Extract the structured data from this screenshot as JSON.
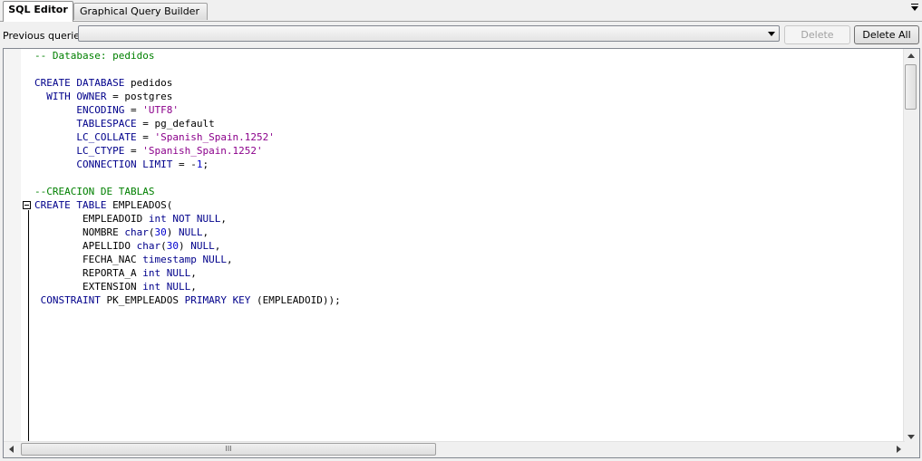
{
  "tabs": [
    {
      "label": "SQL Editor",
      "active": true
    },
    {
      "label": "Graphical Query Builder",
      "active": false
    }
  ],
  "previous_queries": {
    "label": "Previous queries",
    "selected": "",
    "delete_label": "Delete",
    "delete_all_label": "Delete All"
  },
  "scrollbar": {
    "h_thumb_grip": "III"
  },
  "editor": {
    "lines": [
      [
        {
          "t": "-- Database: pedidos",
          "c": "com"
        }
      ],
      [],
      [
        {
          "t": "CREATE",
          "c": "kw"
        },
        {
          "t": " "
        },
        {
          "t": "DATABASE",
          "c": "kw"
        },
        {
          "t": " pedidos"
        }
      ],
      [
        {
          "t": "  "
        },
        {
          "t": "WITH",
          "c": "kw"
        },
        {
          "t": " "
        },
        {
          "t": "OWNER",
          "c": "kw"
        },
        {
          "t": " = postgres"
        }
      ],
      [
        {
          "t": "       "
        },
        {
          "t": "ENCODING",
          "c": "kw"
        },
        {
          "t": " = "
        },
        {
          "t": "'UTF8'",
          "c": "str"
        }
      ],
      [
        {
          "t": "       "
        },
        {
          "t": "TABLESPACE",
          "c": "kw"
        },
        {
          "t": " = pg_default"
        }
      ],
      [
        {
          "t": "       "
        },
        {
          "t": "LC_COLLATE",
          "c": "kw"
        },
        {
          "t": " = "
        },
        {
          "t": "'Spanish_Spain.1252'",
          "c": "str"
        }
      ],
      [
        {
          "t": "       "
        },
        {
          "t": "LC_CTYPE",
          "c": "kw"
        },
        {
          "t": " = "
        },
        {
          "t": "'Spanish_Spain.1252'",
          "c": "str"
        }
      ],
      [
        {
          "t": "       "
        },
        {
          "t": "CONNECTION",
          "c": "kw"
        },
        {
          "t": " "
        },
        {
          "t": "LIMIT",
          "c": "kw"
        },
        {
          "t": " = -"
        },
        {
          "t": "1",
          "c": "num"
        },
        {
          "t": ";"
        }
      ],
      [],
      [
        {
          "t": "--CREACION DE TABLAS",
          "c": "com"
        }
      ],
      [
        {
          "t": "CREATE",
          "c": "kw"
        },
        {
          "t": " "
        },
        {
          "t": "TABLE",
          "c": "kw"
        },
        {
          "t": " EMPLEADOS("
        }
      ],
      [
        {
          "t": "        EMPLEADOID "
        },
        {
          "t": "int",
          "c": "kw"
        },
        {
          "t": " "
        },
        {
          "t": "NOT",
          "c": "kw"
        },
        {
          "t": " "
        },
        {
          "t": "NULL",
          "c": "kw"
        },
        {
          "t": ","
        }
      ],
      [
        {
          "t": "        NOMBRE "
        },
        {
          "t": "char",
          "c": "kw"
        },
        {
          "t": "("
        },
        {
          "t": "30",
          "c": "num"
        },
        {
          "t": ") "
        },
        {
          "t": "NULL",
          "c": "kw"
        },
        {
          "t": ","
        }
      ],
      [
        {
          "t": "        APELLIDO "
        },
        {
          "t": "char",
          "c": "kw"
        },
        {
          "t": "("
        },
        {
          "t": "30",
          "c": "num"
        },
        {
          "t": ") "
        },
        {
          "t": "NULL",
          "c": "kw"
        },
        {
          "t": ","
        }
      ],
      [
        {
          "t": "        FECHA_NAC "
        },
        {
          "t": "timestamp",
          "c": "kw"
        },
        {
          "t": " "
        },
        {
          "t": "NULL",
          "c": "kw"
        },
        {
          "t": ","
        }
      ],
      [
        {
          "t": "        REPORTA_A "
        },
        {
          "t": "int",
          "c": "kw"
        },
        {
          "t": " "
        },
        {
          "t": "NULL",
          "c": "kw"
        },
        {
          "t": ","
        }
      ],
      [
        {
          "t": "        EXTENSION "
        },
        {
          "t": "int",
          "c": "kw"
        },
        {
          "t": " "
        },
        {
          "t": "NULL",
          "c": "kw"
        },
        {
          "t": ","
        }
      ],
      [
        {
          "t": " "
        },
        {
          "t": "CONSTRAINT",
          "c": "kw"
        },
        {
          "t": " PK_EMPLEADOS "
        },
        {
          "t": "PRIMARY",
          "c": "kw"
        },
        {
          "t": " "
        },
        {
          "t": "KEY",
          "c": "kw"
        },
        {
          "t": " (EMPLEADOID));"
        }
      ]
    ]
  },
  "colors": {
    "keyword": "#00008b",
    "string": "#8b008b",
    "number": "#0000cd",
    "comment": "#008000"
  }
}
